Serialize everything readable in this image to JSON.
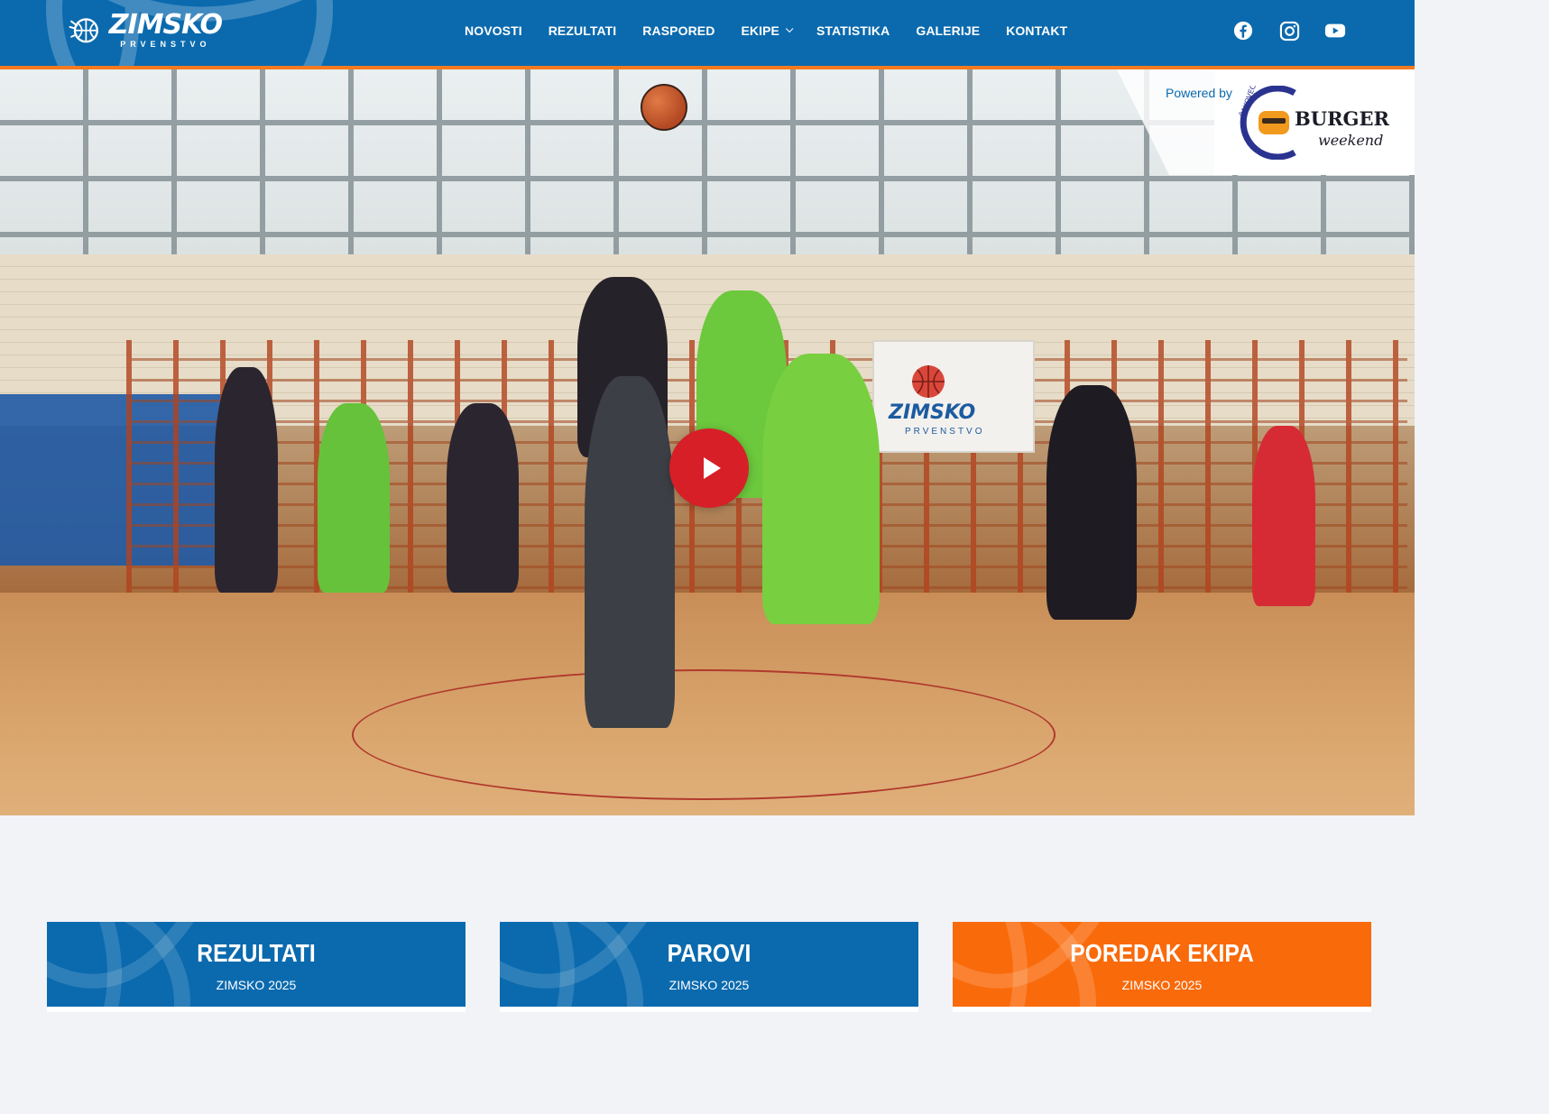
{
  "brand": {
    "logo_main": "ZIMSKO",
    "logo_sub": "PRVENSTVO"
  },
  "nav": {
    "items": [
      {
        "label": "NOVOSTI"
      },
      {
        "label": "REZULTATI"
      },
      {
        "label": "RASPORED"
      },
      {
        "label": "EKIPE",
        "has_dropdown": true
      },
      {
        "label": "STATISTIKA"
      },
      {
        "label": "GALERIJE"
      },
      {
        "label": "KONTAKT"
      }
    ]
  },
  "social": [
    {
      "icon": "facebook-icon"
    },
    {
      "icon": "instagram-icon"
    },
    {
      "icon": "youtube-icon"
    }
  ],
  "sponsor": {
    "label": "Powered by",
    "logo_text_top": "BURGER",
    "logo_text_bottom": "weekend",
    "logo_arc": "ČAKOVEC"
  },
  "hero": {
    "banner_text": "ZIMSKO",
    "banner_sub": "PRVENSTVO",
    "play_icon": "play-icon"
  },
  "cards": [
    {
      "title": "REZULTATI",
      "subtitle": "ZIMSKO 2025",
      "color": "#0b6aae"
    },
    {
      "title": "PAROVI",
      "subtitle": "ZIMSKO 2025",
      "color": "#0b6aae"
    },
    {
      "title": "POREDAK EKIPA",
      "subtitle": "ZIMSKO 2025",
      "color": "#f96a0b"
    }
  ],
  "colors": {
    "header_blue": "#0b6aae",
    "accent_orange": "#f47a20",
    "play_red": "#d61f26",
    "background": "#f1f3f7"
  }
}
